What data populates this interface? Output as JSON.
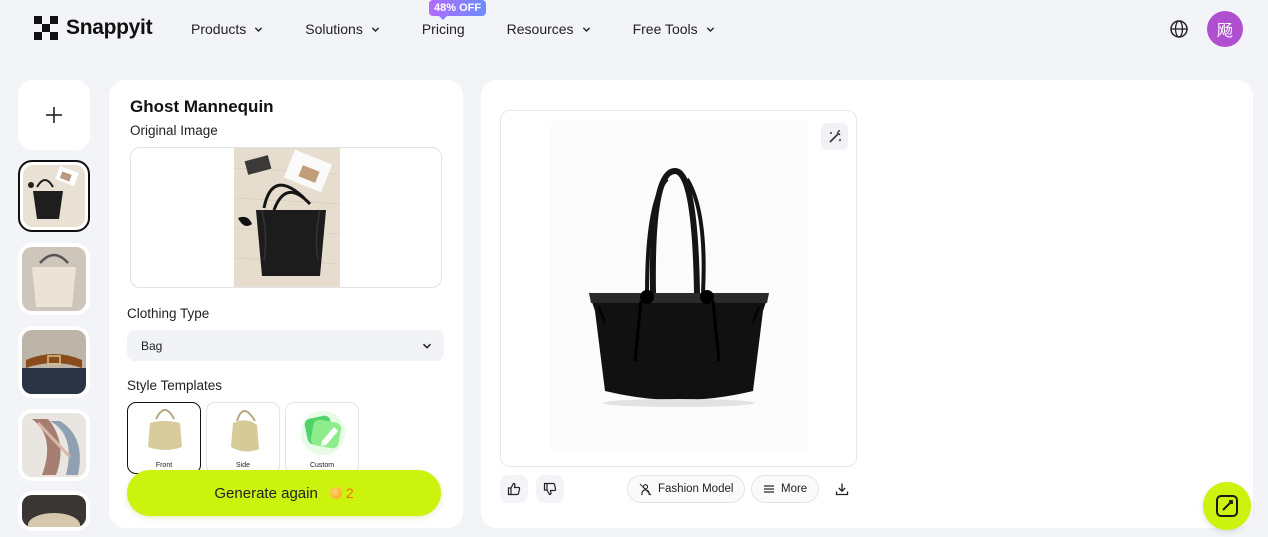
{
  "brand": {
    "name": "Snappyit"
  },
  "nav": {
    "items": [
      {
        "label": "Products"
      },
      {
        "label": "Solutions"
      },
      {
        "label": "Pricing"
      },
      {
        "label": "Resources"
      },
      {
        "label": "Free Tools"
      }
    ],
    "promo_badge": "48% OFF"
  },
  "user": {
    "avatar_text": "飏"
  },
  "panel": {
    "title": "Ghost Mannequin",
    "original_image_label": "Original Image",
    "clothing_type_label": "Clothing Type",
    "clothing_type_value": "Bag",
    "style_templates_label": "Style Templates",
    "templates": [
      {
        "label": "Front"
      },
      {
        "label": "Side"
      },
      {
        "label": "Custom"
      }
    ],
    "generate_label": "Generate again",
    "credits": "2"
  },
  "result": {
    "fashion_model_label": "Fashion Model",
    "more_label": "More"
  },
  "colors": {
    "accent": "#cbf30e",
    "avatar": "#b04fd0",
    "credit": "#ff6a00"
  }
}
